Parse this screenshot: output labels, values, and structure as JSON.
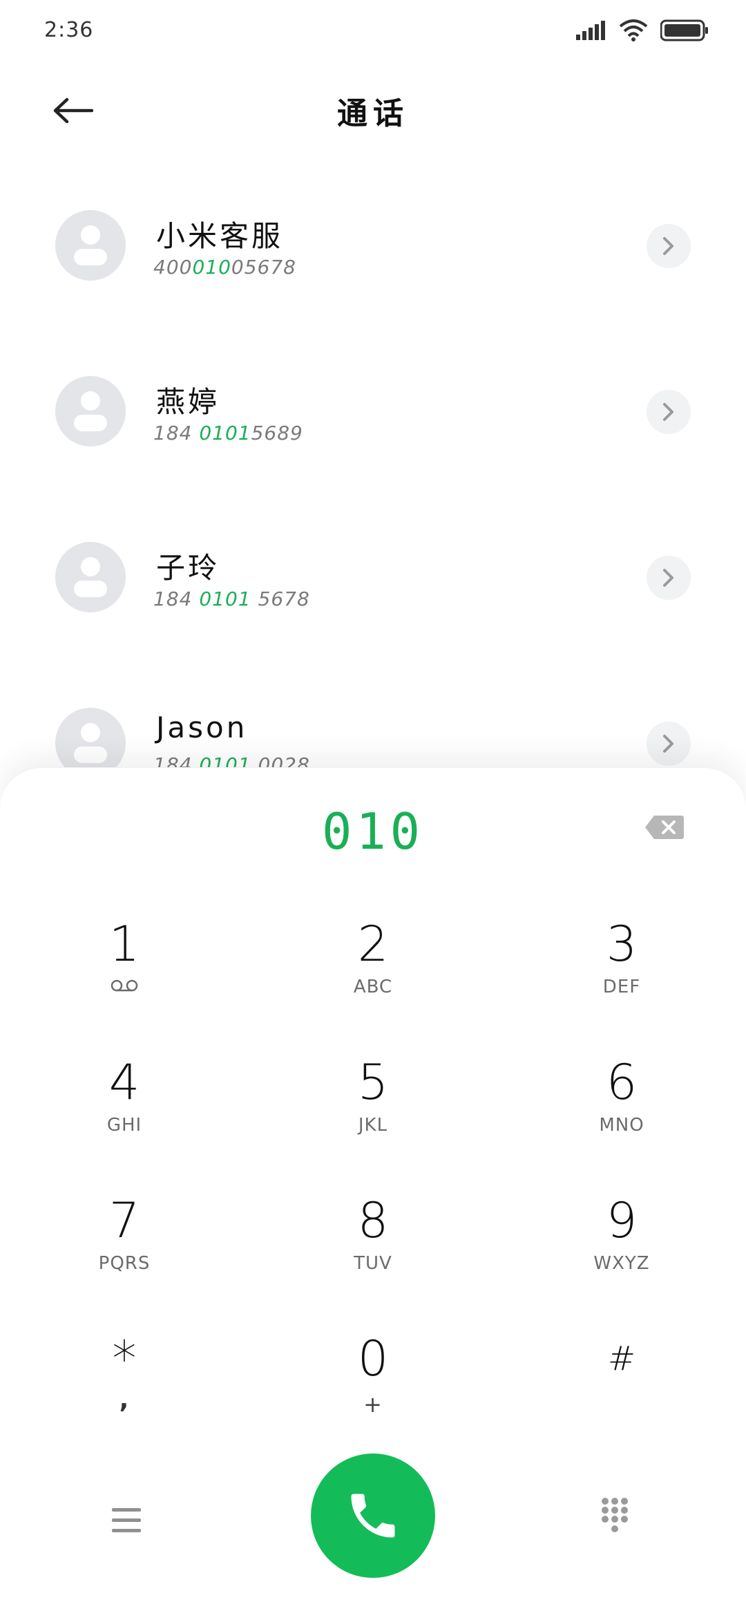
{
  "status_bar": {
    "time": "2:36"
  },
  "header": {
    "title": "通话"
  },
  "contacts": [
    {
      "name": "小米客服",
      "number_pre": "400",
      "number_match": "010",
      "number_post": "05678"
    },
    {
      "name": "燕婷",
      "number_pre": "184 ",
      "number_match": "0101",
      "number_post": "5689"
    },
    {
      "name": "子玲",
      "number_pre": "184 ",
      "number_match": "0101",
      "number_post": " 5678"
    },
    {
      "name": "Jason",
      "number_pre": "184 ",
      "number_match": "0101",
      "number_post": " 0028"
    }
  ],
  "dialer": {
    "input": "010",
    "keys": [
      {
        "digit": "1",
        "letters": ""
      },
      {
        "digit": "2",
        "letters": "ABC"
      },
      {
        "digit": "3",
        "letters": "DEF"
      },
      {
        "digit": "4",
        "letters": "GHI"
      },
      {
        "digit": "5",
        "letters": "JKL"
      },
      {
        "digit": "6",
        "letters": "MNO"
      },
      {
        "digit": "7",
        "letters": "PQRS"
      },
      {
        "digit": "8",
        "letters": "TUV"
      },
      {
        "digit": "9",
        "letters": "WXYZ"
      },
      {
        "digit": "*",
        "letters": ","
      },
      {
        "digit": "0",
        "letters": "+"
      },
      {
        "digit": "#",
        "letters": ""
      }
    ]
  },
  "colors": {
    "accent": "#1aaf57",
    "call_button": "#13bc58",
    "avatar_bg": "#e3e5e8"
  },
  "icons": {
    "back": "back-arrow-icon",
    "backspace": "backspace-icon",
    "voicemail": "voicemail-icon",
    "menu": "menu-icon",
    "call": "phone-icon",
    "keypad": "dialpad-icon"
  }
}
